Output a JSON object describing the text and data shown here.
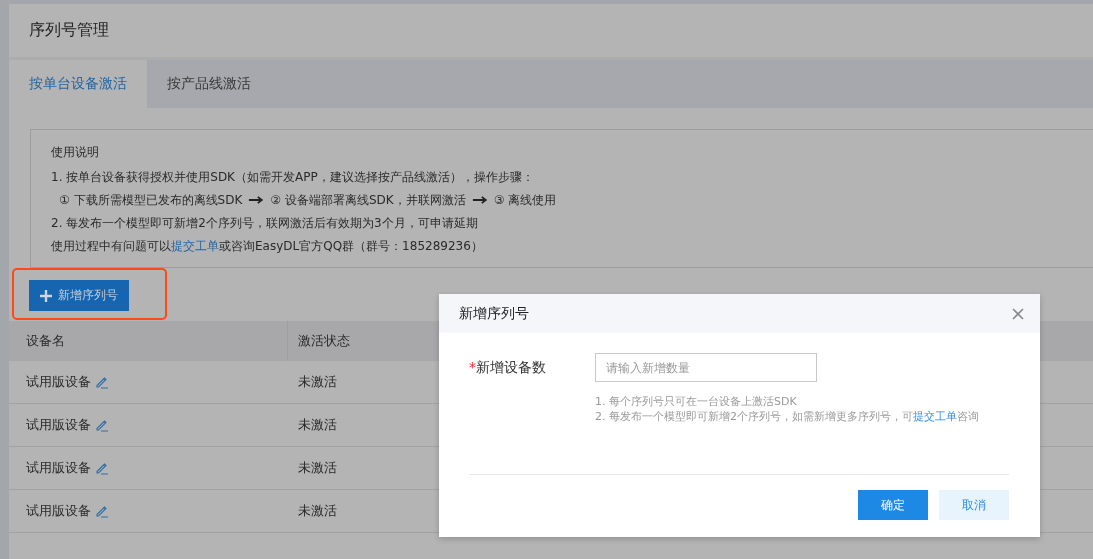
{
  "page": {
    "title": "序列号管理"
  },
  "tabs": [
    {
      "label": "按单台设备激活",
      "selected": true
    },
    {
      "label": "按产品线激活",
      "selected": false
    }
  ],
  "instructions": {
    "heading": "使用说明",
    "line_1": "1. 按单台设备获得授权并使用SDK（如需开发APP，建议选择按产品线激活），操作步骤：",
    "steps": [
      "① 下载所需模型已发布的离线SDK",
      "② 设备端部署离线SDK，并联网激活",
      "③ 离线使用"
    ],
    "line_2": "2. 每发布一个模型即可新增2个序列号，联网激活后有效期为3个月，可申请延期",
    "help_prefix": "使用过程中有问题可以",
    "help_link": "提交工单",
    "help_suffix": "或咨询EasyDL官方QQ群（群号：185289236）"
  },
  "add_button": "新增序列号",
  "table": {
    "columns": [
      "设备名",
      "激活状态"
    ],
    "rows": [
      {
        "device": "试用版设备",
        "status": "未激活"
      },
      {
        "device": "试用版设备",
        "status": "未激活"
      },
      {
        "device": "试用版设备",
        "status": "未激活"
      },
      {
        "device": "试用版设备",
        "status": "未激活"
      }
    ]
  },
  "dialog": {
    "title": "新增序列号",
    "field": {
      "required_mark": "*",
      "label": "新增设备数",
      "placeholder": "请输入新增数量"
    },
    "hint_1": "1. 每个序列号只可在一台设备上激活SDK",
    "hint_2_prefix": "2. 每发布一个模型即可新增2个序列号，如需新增更多序列号，可",
    "hint_2_link": "提交工单",
    "hint_2_suffix": "咨询",
    "buttons": [
      {
        "label": "确定",
        "kind": "primary"
      },
      {
        "label": "取消",
        "kind": "secondary"
      }
    ]
  }
}
